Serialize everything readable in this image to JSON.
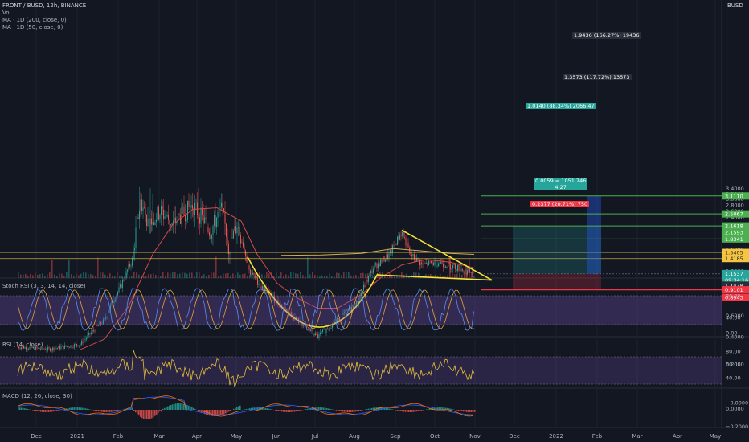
{
  "header": {
    "symbol": "FRONT / BUSD, 12h, BINANCE",
    "volume_label": "Vol",
    "ma200_label": "MA · 1D (200, close, 0)",
    "ma50_label": "MA · 1D (50, close, 0)",
    "currency": "BUSD"
  },
  "panes": {
    "stoch_rsi": "Stoch RSI (3, 3, 14, 14, close)",
    "rsi": "RSI (14, close)",
    "macd": "MACD (12, 26, close, 30)"
  },
  "axis": {
    "price_ticks": [
      "3.4000",
      "3.2000",
      "3.0000",
      "2.8000",
      "2.6000",
      "2.4000",
      "2.2000",
      "2.0000",
      "1.8000",
      "1.6000",
      "1.2000",
      "1.0000",
      "0.8000",
      "0.6000",
      "0.4000",
      "0.2000",
      "−0.0000"
    ],
    "stoch_ticks": [
      "80.00",
      "40.00",
      "0.00"
    ],
    "rsi_ticks": [
      "80.00",
      "60.00",
      "40.00"
    ],
    "macd_ticks": [
      "0.0000",
      "−0.2000"
    ],
    "time_labels": [
      "Dec",
      "2021",
      "Feb",
      "Mar",
      "Apr",
      "May",
      "Jun",
      "Jul",
      "Aug",
      "Sep",
      "Oct",
      "Nov",
      "Dec",
      "2022",
      "Feb",
      "Mar",
      "Apr",
      "May"
    ]
  },
  "price_markers": [
    {
      "value": "3.1110",
      "color": "#4caf50"
    },
    {
      "value": "2.5067",
      "color": "#4caf50"
    },
    {
      "value": "2.1618",
      "color": "#4caf50"
    },
    {
      "value": "2.1593",
      "color": "#4caf50"
    },
    {
      "value": "1.8341",
      "color": "#4caf50"
    },
    {
      "value": "1.5405",
      "color": "#f5c542"
    },
    {
      "value": "1.4185",
      "color": "#f5c542"
    },
    {
      "value": "1.1537",
      "color": "#26a69a"
    },
    {
      "value": "09:34:16",
      "color": "#26a69a"
    },
    {
      "value": "1.1478",
      "color": "#2a2e39"
    },
    {
      "value": "0.9101",
      "color": "#f23645"
    },
    {
      "value": "0.8943",
      "color": "#f23645"
    }
  ],
  "annotations": {
    "target3": "1.9436 (166.27%) 19436",
    "target2": "1.3573 (117.72%) 13573",
    "target1": "1.0140 (88.34%) 2066.47",
    "entry_line1": "0.0059 = 1051.746",
    "entry_line2": "4.27",
    "stop": "0.2377 (20.71%) 750"
  },
  "colors": {
    "background": "#131722",
    "up": "#26a69a",
    "down": "#ef5350",
    "ma200": "#c9b458",
    "ma50": "#d04a4a",
    "pattern": "#f2e337",
    "target_line": "#4caf50",
    "stop_line": "#f23645",
    "resistance": "#f5c542",
    "stoch_k": "#5b8cf0",
    "stoch_d": "#e6a23c",
    "rsi_line": "#e6c13c"
  },
  "chart_data": [
    {
      "type": "candlestick",
      "title": "FRONT / BUSD, 12h, BINANCE",
      "ylim": [
        -0.05,
        3.45
      ],
      "x": [
        "2020-12",
        "2021-01",
        "2021-02",
        "2021-03",
        "2021-04",
        "2021-05",
        "2021-06",
        "2021-07",
        "2021-08",
        "2021-09",
        "2021-10",
        "2021-11"
      ],
      "approx_close": [
        0.3,
        0.35,
        0.9,
        2.9,
        2.6,
        2.5,
        0.8,
        0.45,
        0.65,
        1.6,
        1.25,
        1.15
      ],
      "series": [
        {
          "name": "MA · 1D (200, close, 0)",
          "values": [
            null,
            null,
            null,
            null,
            null,
            null,
            null,
            null,
            1.48,
            1.62,
            1.55,
            1.5
          ]
        },
        {
          "name": "MA · 1D (50, close, 0)",
          "values": [
            null,
            0.3,
            0.4,
            1.3,
            2.75,
            2.7,
            1.5,
            0.75,
            0.7,
            1.1,
            1.3,
            1.25
          ]
        }
      ],
      "levels": {
        "targets": [
          3.111,
          2.5067,
          2.1618,
          1.8341
        ],
        "resistance": [
          1.5405,
          1.4185
        ],
        "entry": 1.1478,
        "stop": 0.9101
      }
    },
    {
      "type": "line",
      "title": "Stoch RSI (3, 3, 14, 14, close)",
      "ylim": [
        0,
        100
      ],
      "bands": [
        20,
        80
      ]
    },
    {
      "type": "line",
      "title": "RSI (14, close)",
      "ylim": [
        30,
        90
      ],
      "bands": [
        30,
        70
      ]
    },
    {
      "type": "bar",
      "title": "MACD (12, 26, close, 30)",
      "ylim": [
        -0.25,
        0.15
      ]
    }
  ]
}
